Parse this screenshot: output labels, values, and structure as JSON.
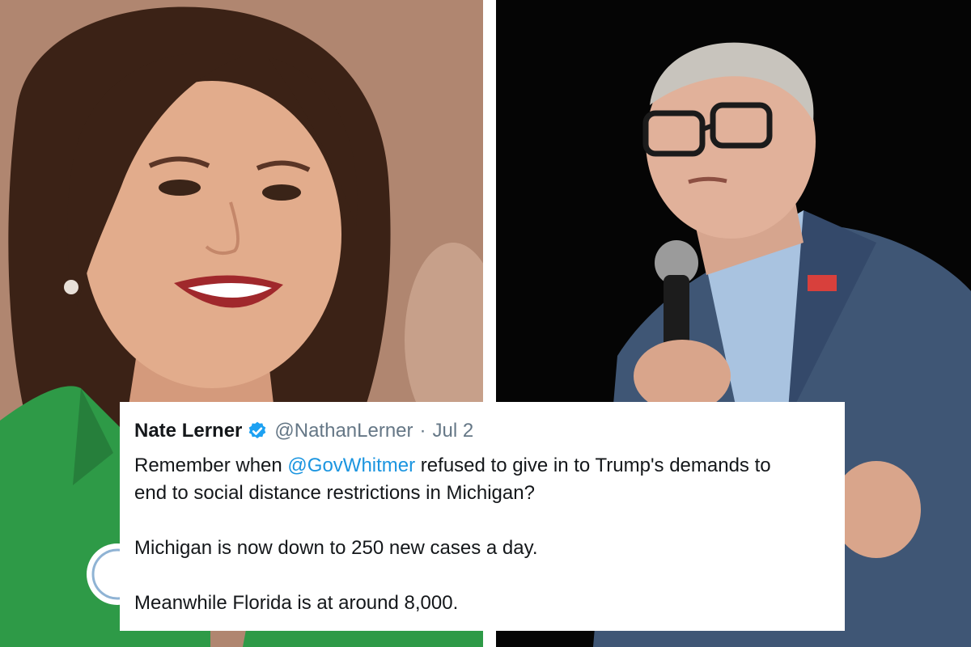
{
  "photos": {
    "left": {
      "subject": "smiling woman in green blazer",
      "background_color": "#b48a74",
      "blazer_color": "#2e9a47"
    },
    "right": {
      "subject": "man with glasses speaking into microphone",
      "background_color": "#050505",
      "suit_color": "#3f5675"
    }
  },
  "tweet": {
    "author_name": "Nate Lerner",
    "verified_icon": "verified-badge-icon",
    "handle": "@NathanLerner",
    "separator": "·",
    "date": "Jul 2",
    "line1_prefix": "Remember when ",
    "mention": "@GovWhitmer",
    "line1_suffix": " refused to give in to Trump's demands to",
    "line2": "end to social distance restrictions in Michigan?",
    "line3": "Michigan is now down to 250 new cases a day.",
    "line4": "Meanwhile Florida is at around 8,000.",
    "mention_color": "#1b95e0",
    "badge_color": "#1da1f2"
  }
}
